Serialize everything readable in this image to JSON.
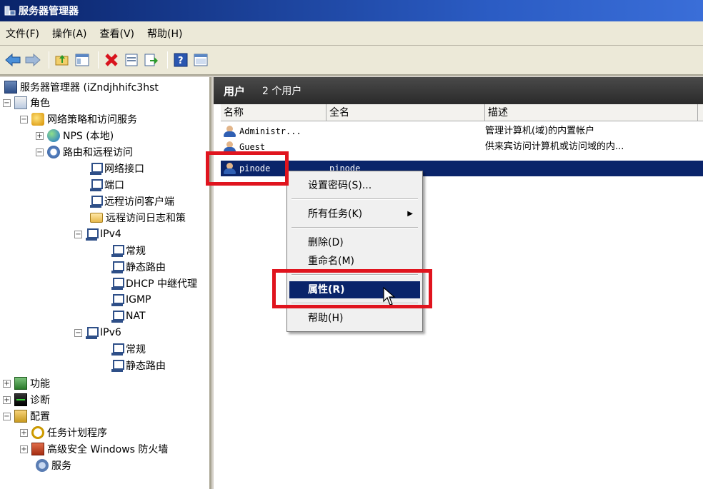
{
  "window": {
    "title": "服务器管理器"
  },
  "menu": [
    "文件(F)",
    "操作(A)",
    "查看(V)",
    "帮助(H)"
  ],
  "toolbar": [
    "back-icon",
    "forward-icon",
    "up-folder-icon",
    "show-tree-icon",
    "delete-icon",
    "properties-icon",
    "export-icon",
    "help-icon",
    "console-icon"
  ],
  "tree": {
    "root": "服务器管理器 (iZndjhhifc3hst",
    "roles": "角色",
    "nps_access": "网络策略和访问服务",
    "nps_local": "NPS (本地)",
    "rras": "路由和远程访问",
    "net_iface": "网络接口",
    "ports": "端口",
    "remote_clients": "远程访问客户端",
    "remote_log": "远程访问日志和策",
    "ipv4": "IPv4",
    "ipv4_general": "常规",
    "ipv4_static": "静态路由",
    "dhcp_relay": "DHCP 中继代理",
    "igmp": "IGMP",
    "nat": "NAT",
    "ipv6": "IPv6",
    "ipv6_general": "常规",
    "ipv6_static": "静态路由",
    "features": "功能",
    "diagnostics": "诊断",
    "config": "配置",
    "task_scheduler": "任务计划程序",
    "firewall": "高级安全 Windows 防火墙",
    "services": "服务"
  },
  "panel": {
    "title": "用户",
    "count": "2 个用户",
    "columns": [
      "名称",
      "全名",
      "描述"
    ],
    "rows": [
      {
        "name": "Administr...",
        "fullname": "",
        "desc": "管理计算机(域)的内置帐户"
      },
      {
        "name": "Guest",
        "fullname": "",
        "desc": "供来宾访问计算机或访问域的内..."
      },
      {
        "name": "pinode",
        "fullname": "pinode",
        "desc": ""
      }
    ]
  },
  "context_menu": {
    "set_password": "设置密码(S)...",
    "all_tasks": "所有任务(K)",
    "delete": "删除(D)",
    "rename": "重命名(M)",
    "properties": "属性(R)",
    "help": "帮助(H)"
  },
  "colors": {
    "highlight": "#0a246a",
    "annotation": "#e0141e"
  }
}
